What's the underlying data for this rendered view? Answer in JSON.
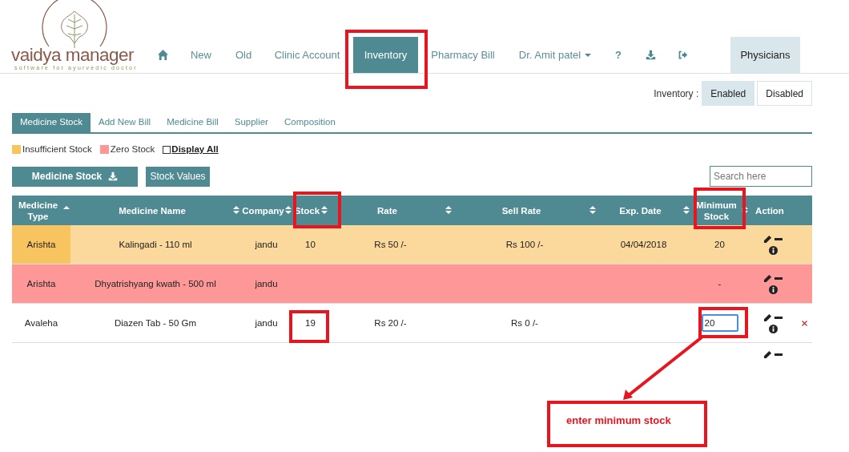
{
  "logo": {
    "name": "vaidya manager",
    "tagline": "software for ayurvedic doctor"
  },
  "nav": [
    {
      "kind": "home"
    },
    {
      "kind": "link",
      "label": "New",
      "selected": false
    },
    {
      "kind": "link",
      "label": "Old",
      "selected": false
    },
    {
      "kind": "link",
      "label": "Clinic Account",
      "selected": false
    },
    {
      "kind": "link",
      "label": "Inventory",
      "selected": true
    },
    {
      "kind": "link",
      "label": "Pharmacy Bill",
      "selected": false
    },
    {
      "kind": "dropdown",
      "label": "Dr. Amit patel",
      "selected": false
    },
    {
      "kind": "help",
      "label": "?",
      "selected": false
    },
    {
      "kind": "download"
    },
    {
      "kind": "logout"
    }
  ],
  "physicians_tab": {
    "label": "Physicians"
  },
  "inventory_toggle": {
    "label": "Inventory :",
    "options": [
      {
        "label": "Enabled",
        "selected": true
      },
      {
        "label": "Disabled",
        "selected": false
      }
    ]
  },
  "tabs": [
    {
      "label": "Medicine Stock",
      "selected": true
    },
    {
      "label": "Add New Bill",
      "selected": false
    },
    {
      "label": "Medicine Bill",
      "selected": false
    },
    {
      "label": "Supplier",
      "selected": false
    },
    {
      "label": "Composition",
      "selected": false
    }
  ],
  "legend": [
    {
      "label": "Insufficient Stock",
      "color": "#f8c460"
    },
    {
      "label": "Zero Stock",
      "color": "#fe9898"
    }
  ],
  "display_all": {
    "label": "Display All",
    "checked": false
  },
  "buttons": {
    "medicine_stock": "Medicine Stock",
    "stock_values": "Stock Values"
  },
  "search": {
    "placeholder": "Search here"
  },
  "table": {
    "columns": [
      {
        "label": "Medicine Type",
        "kind": "ascending"
      },
      {
        "label": "Medicine Name",
        "kind": "sortable"
      },
      {
        "label": "Company",
        "kind": "sortable"
      },
      {
        "label": "Stock",
        "kind": "sortable"
      },
      {
        "label": "Rate",
        "kind": "sortable"
      },
      {
        "label": "Sell Rate",
        "kind": "sortable"
      },
      {
        "label": "Exp. Date",
        "kind": "sortable"
      },
      {
        "label": "Minimum Stock",
        "kind": "sortable"
      },
      {
        "label": "Action",
        "kind": "plain"
      }
    ],
    "rows": [
      {
        "kind": "insufficient",
        "editing": false,
        "type": "Arishta",
        "name": "Kalingadi - 110 ml",
        "company": "jandu",
        "stock": "10",
        "rate": "Rs 50 /-",
        "sell_rate": "Rs 100 /-",
        "exp_date": "04/04/2018",
        "min_stock": "20"
      },
      {
        "kind": "zero",
        "editing": false,
        "type": "Arishta",
        "name": "Dhyatrishyang kwath - 500 ml",
        "company": "jandu",
        "min_stock": "-"
      },
      {
        "kind": "normal",
        "editing": true,
        "type": "Avaleha",
        "name": "Diazen Tab - 50 Gm",
        "company": "jandu",
        "stock": "19",
        "rate": "Rs 20 /-",
        "sell_rate": "Rs 0 /-",
        "min_stock": "20"
      }
    ]
  },
  "annotation": {
    "callout": "enter minimum stock"
  }
}
